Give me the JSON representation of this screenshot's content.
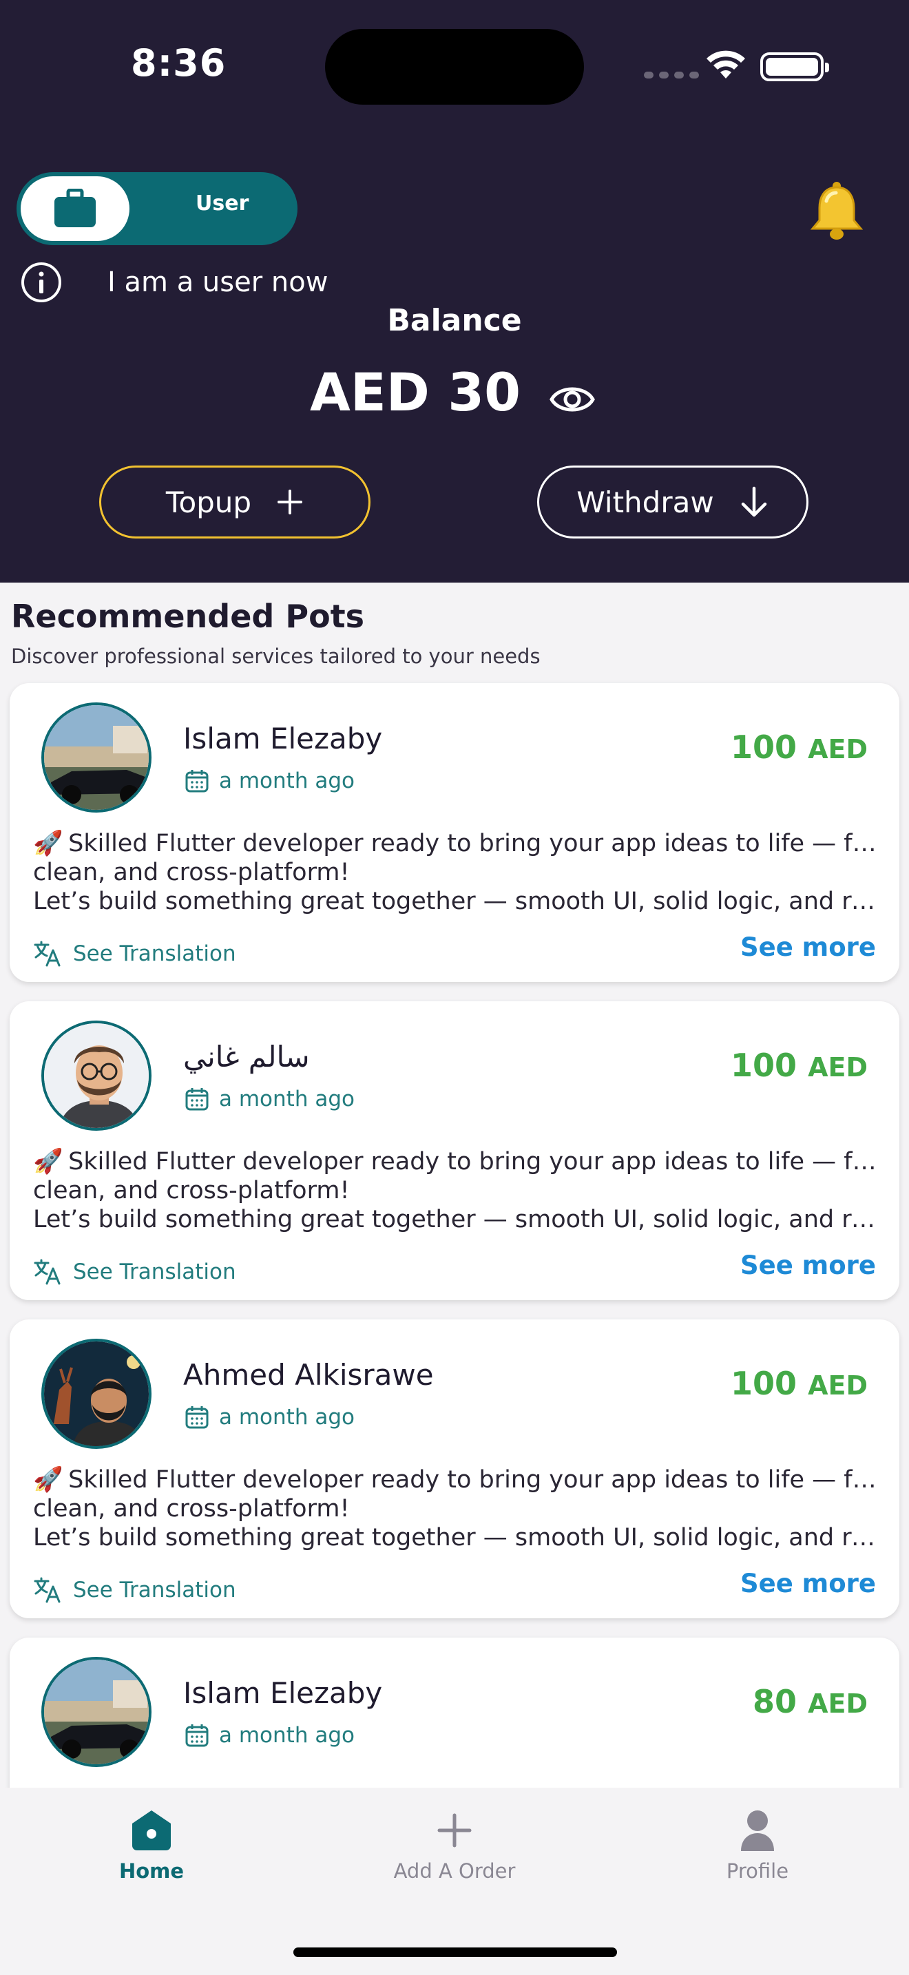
{
  "status_bar": {
    "time": "8:36"
  },
  "header": {
    "role_label": "User",
    "info_text": "I am a user now",
    "balance_label": "Balance",
    "balance_value": "AED 30",
    "topup_label": "Topup",
    "withdraw_label": "Withdraw"
  },
  "section": {
    "title": "Recommended Pots",
    "subtitle": "Discover professional services tailored to your needs"
  },
  "cards": [
    {
      "name": "Islam Elezaby",
      "date": "a month ago",
      "price": "100",
      "currency": "AED",
      "line1": "Skilled Flutter developer ready to bring your app ideas to life — fast,",
      "line2": "clean, and cross-platform!",
      "line3": "Let’s build something great together — smooth UI, solid logic, and real …",
      "translate": "See Translation",
      "see_more": "See more"
    },
    {
      "name": "سالم غاني",
      "date": "a month ago",
      "price": "100",
      "currency": "AED",
      "line1": "Skilled Flutter developer ready to bring your app ideas to life — fast,",
      "line2": "clean, and cross-platform!",
      "line3": "Let’s build something great together — smooth UI, solid logic, and real …",
      "translate": "See Translation",
      "see_more": "See more"
    },
    {
      "name": "Ahmed Alkisrawe",
      "date": "a month ago",
      "price": "100",
      "currency": "AED",
      "line1": "Skilled Flutter developer ready to bring your app ideas to life — fast,",
      "line2": "clean, and cross-platform!",
      "line3": "Let’s build something great together — smooth UI, solid logic, and real …",
      "translate": "See Translation",
      "see_more": "See more"
    },
    {
      "name": "Islam Elezaby",
      "date": "a month ago",
      "price": "80",
      "currency": "AED"
    }
  ],
  "bottom_nav": {
    "home": "Home",
    "add": "Add A Order",
    "profile": "Profile"
  },
  "colors": {
    "header_bg": "#231d35",
    "teal": "#0c6a73",
    "price_green": "#43a947",
    "link_blue": "#1e8ad6",
    "topup_border": "#f2c230"
  }
}
